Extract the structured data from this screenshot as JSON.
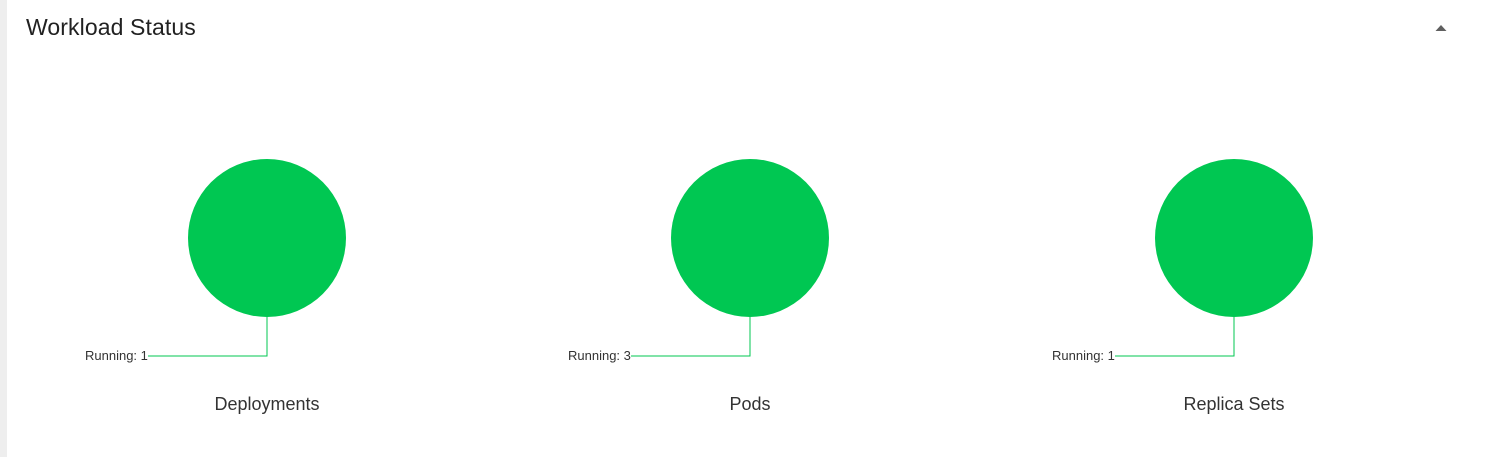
{
  "card": {
    "title": "Workload Status",
    "collapse_icon": "triangle-up-icon"
  },
  "colors": {
    "running": "#00c752",
    "leader_line": "#00c752",
    "text": "#333333"
  },
  "charts": [
    {
      "name": "Deployments",
      "running_label": "Running: 1",
      "chart_data": {
        "type": "pie",
        "categories": [
          "Running"
        ],
        "values": [
          1
        ]
      }
    },
    {
      "name": "Pods",
      "running_label": "Running: 3",
      "chart_data": {
        "type": "pie",
        "categories": [
          "Running"
        ],
        "values": [
          3
        ]
      }
    },
    {
      "name": "Replica Sets",
      "running_label": "Running: 1",
      "chart_data": {
        "type": "pie",
        "categories": [
          "Running"
        ],
        "values": [
          1
        ]
      }
    }
  ]
}
